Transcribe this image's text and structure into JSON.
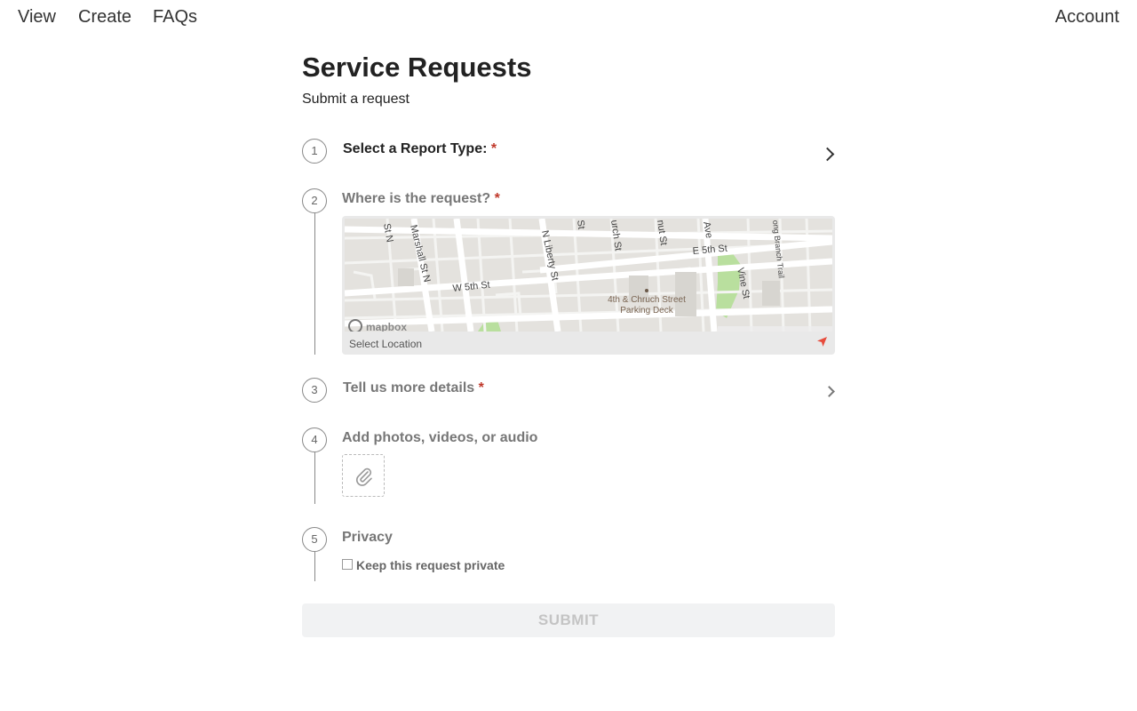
{
  "nav": {
    "view": "View",
    "create": "Create",
    "faqs": "FAQs",
    "account": "Account"
  },
  "header": {
    "title": "Service Requests",
    "subtitle": "Submit a request"
  },
  "steps": [
    {
      "number": "1",
      "label": "Select a Report Type:",
      "required": "*"
    },
    {
      "number": "2",
      "label": "Where is the request?",
      "required": "*"
    },
    {
      "number": "3",
      "label": "Tell us more details",
      "required": "*"
    },
    {
      "number": "4",
      "label": "Add photos, videos, or audio"
    },
    {
      "number": "5",
      "label": "Privacy"
    }
  ],
  "map": {
    "footer_label": "Select Location",
    "streets": {
      "w5th": "W 5th St",
      "e5th": "E 5th St",
      "marshall": "Marshall St N",
      "nliberty": "N Liberty St",
      "vine": "Vine St",
      "ave": "Ave",
      "stn": "St N",
      "church": "urch St",
      "nut": "nut St",
      "st": "St",
      "longbranch": "ong Branch Trail"
    },
    "poi_line1": "4th & Chruch Street",
    "poi_line2": "Parking Deck",
    "logo_text": "mapbox"
  },
  "privacy": {
    "checkbox_label": "Keep this request private",
    "checked": false
  },
  "submit": {
    "label": "SUBMIT"
  },
  "colors": {
    "required": "#c0392b",
    "location_arrow": "#e74c3c",
    "submit_bg": "#f1f2f3",
    "submit_text": "#c4c4c4"
  },
  "icons": {
    "step1_chevron": "chevron-right-icon",
    "step3_chevron": "chevron-right-icon",
    "attach": "paperclip-icon",
    "location": "location-arrow-icon"
  }
}
